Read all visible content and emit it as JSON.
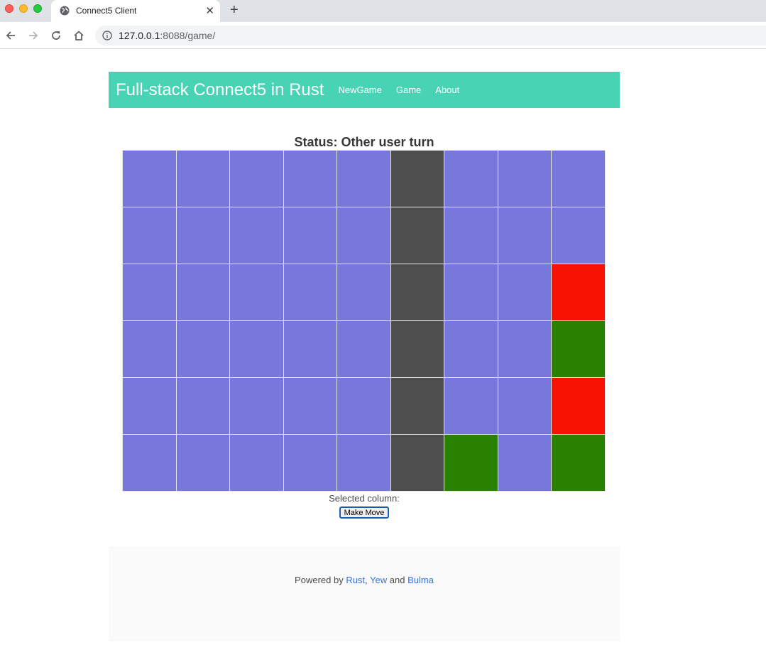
{
  "browser": {
    "tab_title": "Connect5 Client",
    "close_label": "✕",
    "new_tab_label": "+",
    "url_host": "127.0.0.1",
    "url_path": ":8088/game/"
  },
  "navbar": {
    "brand": "Full-stack Connect5 in Rust",
    "links": [
      "NewGame",
      "Game",
      "About"
    ]
  },
  "game": {
    "status": "Status: Other user turn",
    "columns": 9,
    "rows": 6,
    "selected_column_column": 5,
    "colors": {
      "empty": "#7777dc",
      "selected": "#4e4e4e",
      "red": "#f71202",
      "green": "#2a8000"
    },
    "board": [
      [
        "e",
        "e",
        "e",
        "e",
        "e",
        "s",
        "e",
        "e",
        "e"
      ],
      [
        "e",
        "e",
        "e",
        "e",
        "e",
        "s",
        "e",
        "e",
        "e"
      ],
      [
        "e",
        "e",
        "e",
        "e",
        "e",
        "s",
        "e",
        "e",
        "r"
      ],
      [
        "e",
        "e",
        "e",
        "e",
        "e",
        "s",
        "e",
        "e",
        "g"
      ],
      [
        "e",
        "e",
        "e",
        "e",
        "e",
        "s",
        "e",
        "e",
        "r"
      ],
      [
        "e",
        "e",
        "e",
        "e",
        "e",
        "s",
        "g",
        "e",
        "g"
      ]
    ],
    "selected_label": "Selected column:",
    "make_move_label": "Make Move"
  },
  "footer": {
    "prefix": "Powered by ",
    "link1": "Rust",
    "sep1": ", ",
    "link2": "Yew",
    "sep2": " and ",
    "link3": "Bulma"
  }
}
